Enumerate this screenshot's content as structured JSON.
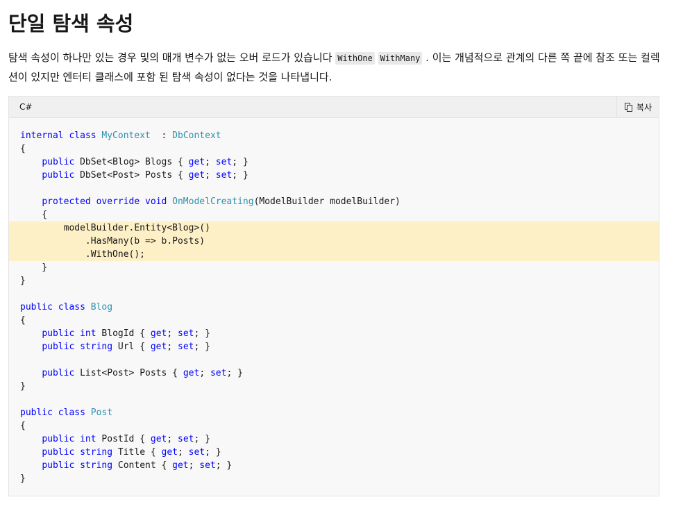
{
  "page": {
    "title": "단일 탐색 속성",
    "paragraph_before": "탐색 속성이 하나만 있는 경우 및의 매개 변수가 없는 오버 로드가 있습니다 ",
    "code_ref_1": "WithOne",
    "code_ref_2": "WithMany",
    "paragraph_after": " . 이는 개념적으로 관계의 다른 쪽 끝에 참조 또는 컬렉션이 있지만 엔터티 클래스에 포함 된 탐색 속성이 없다는 것을 나타냅니다."
  },
  "code_block": {
    "language": "C#",
    "copy_label": "복사",
    "copy_icon": "copy-icon",
    "highlight_color": "#fdf0c6",
    "lines": [
      [
        [
          "kw",
          "internal class "
        ],
        [
          "ty",
          "MyContext"
        ],
        [
          "",
          "  : "
        ],
        [
          "ty",
          "DbContext"
        ]
      ],
      [
        [
          "",
          "{"
        ]
      ],
      [
        [
          "",
          "    "
        ],
        [
          "kw",
          "public"
        ],
        [
          "",
          " DbSet<Blog> Blogs { "
        ],
        [
          "kw",
          "get"
        ],
        [
          "",
          "; "
        ],
        [
          "kw",
          "set"
        ],
        [
          "",
          "; }"
        ]
      ],
      [
        [
          "",
          "    "
        ],
        [
          "kw",
          "public"
        ],
        [
          "",
          " DbSet<Post> Posts { "
        ],
        [
          "kw",
          "get"
        ],
        [
          "",
          "; "
        ],
        [
          "kw",
          "set"
        ],
        [
          "",
          "; }"
        ]
      ],
      [
        [
          "",
          ""
        ]
      ],
      [
        [
          "",
          "    "
        ],
        [
          "kw",
          "protected override void "
        ],
        [
          "fn",
          "OnModelCreating"
        ],
        [
          "",
          "(ModelBuilder modelBuilder)"
        ]
      ],
      [
        [
          "",
          "    {"
        ]
      ],
      [
        [
          "",
          "        modelBuilder.Entity<Blog>()"
        ]
      ],
      [
        [
          "",
          "            .HasMany(b => b.Posts)"
        ]
      ],
      [
        [
          "",
          "            .WithOne();"
        ]
      ],
      [
        [
          "",
          "    }"
        ]
      ],
      [
        [
          "",
          "}"
        ]
      ],
      [
        [
          "",
          ""
        ]
      ],
      [
        [
          "kw",
          "public class "
        ],
        [
          "ty",
          "Blog"
        ]
      ],
      [
        [
          "",
          "{"
        ]
      ],
      [
        [
          "",
          "    "
        ],
        [
          "kw",
          "public int"
        ],
        [
          "",
          " BlogId { "
        ],
        [
          "kw",
          "get"
        ],
        [
          "",
          "; "
        ],
        [
          "kw",
          "set"
        ],
        [
          "",
          "; }"
        ]
      ],
      [
        [
          "",
          "    "
        ],
        [
          "kw",
          "public string"
        ],
        [
          "",
          " Url { "
        ],
        [
          "kw",
          "get"
        ],
        [
          "",
          "; "
        ],
        [
          "kw",
          "set"
        ],
        [
          "",
          "; }"
        ]
      ],
      [
        [
          "",
          ""
        ]
      ],
      [
        [
          "",
          "    "
        ],
        [
          "kw",
          "public"
        ],
        [
          "",
          " List<Post> Posts { "
        ],
        [
          "kw",
          "get"
        ],
        [
          "",
          "; "
        ],
        [
          "kw",
          "set"
        ],
        [
          "",
          "; }"
        ]
      ],
      [
        [
          "",
          "}"
        ]
      ],
      [
        [
          "",
          ""
        ]
      ],
      [
        [
          "kw",
          "public class "
        ],
        [
          "ty",
          "Post"
        ]
      ],
      [
        [
          "",
          "{"
        ]
      ],
      [
        [
          "",
          "    "
        ],
        [
          "kw",
          "public int"
        ],
        [
          "",
          " PostId { "
        ],
        [
          "kw",
          "get"
        ],
        [
          "",
          "; "
        ],
        [
          "kw",
          "set"
        ],
        [
          "",
          "; }"
        ]
      ],
      [
        [
          "",
          "    "
        ],
        [
          "kw",
          "public string"
        ],
        [
          "",
          " Title { "
        ],
        [
          "kw",
          "get"
        ],
        [
          "",
          "; "
        ],
        [
          "kw",
          "set"
        ],
        [
          "",
          "; }"
        ]
      ],
      [
        [
          "",
          "    "
        ],
        [
          "kw",
          "public string"
        ],
        [
          "",
          " Content { "
        ],
        [
          "kw",
          "get"
        ],
        [
          "",
          "; "
        ],
        [
          "kw",
          "set"
        ],
        [
          "",
          "; }"
        ]
      ],
      [
        [
          "",
          "}"
        ]
      ]
    ],
    "highlighted_lines": [
      7,
      8,
      9
    ]
  }
}
